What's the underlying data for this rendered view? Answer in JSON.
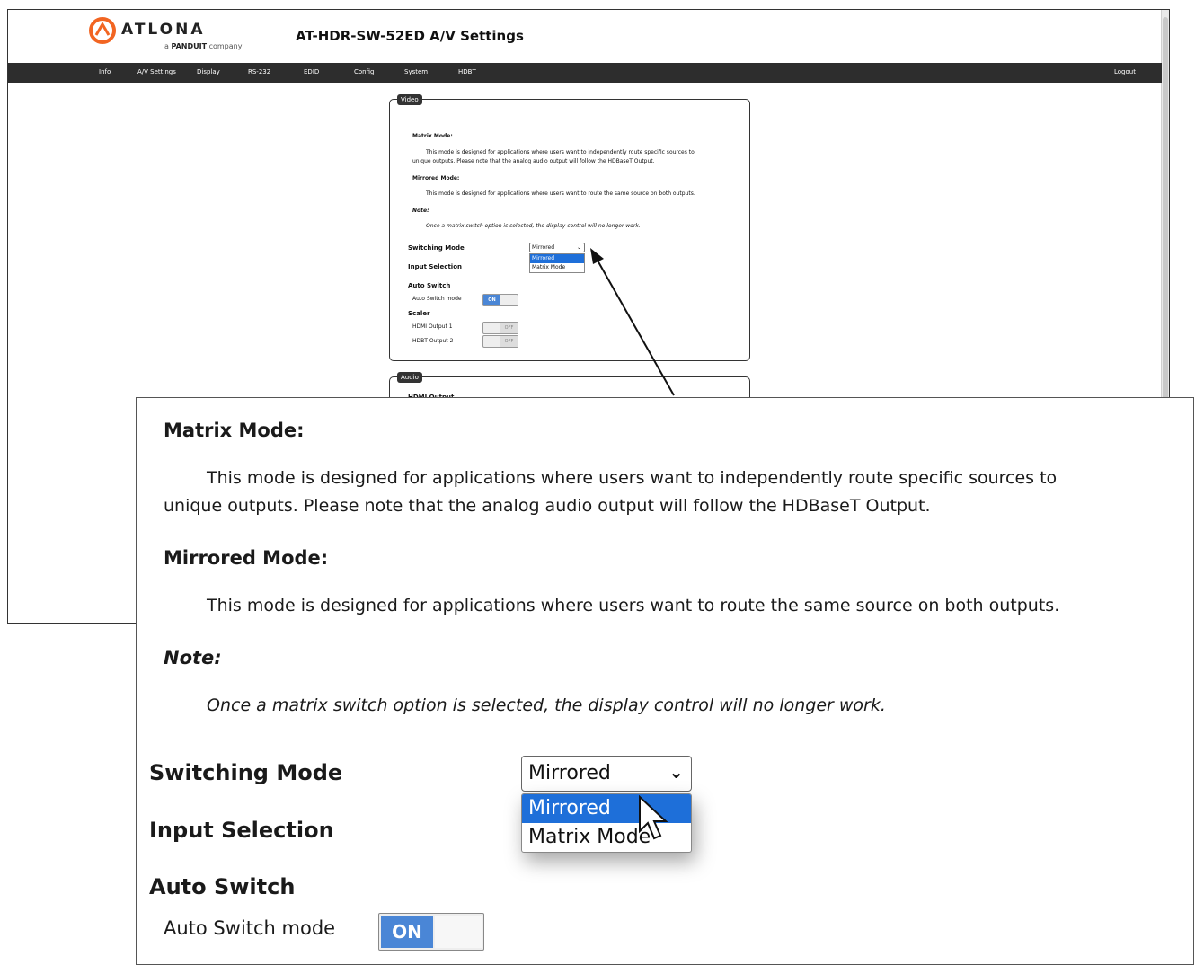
{
  "brand": {
    "name": "ATLONA",
    "tagline_prefix": "a",
    "tagline_brand": "PANDUIT",
    "tagline_suffix": "company",
    "accent": "#f26522"
  },
  "page": {
    "title": "AT-HDR-SW-52ED  A/V Settings"
  },
  "nav": {
    "items": [
      "Info",
      "A/V Settings",
      "Display",
      "RS-232",
      "EDID",
      "Config",
      "System",
      "HDBT"
    ],
    "logout": "Logout",
    "background": "#2d2d2d"
  },
  "video_panel": {
    "legend": "Video",
    "matrix_heading": "Matrix Mode:",
    "matrix_line1": "This mode is designed for applications where users want to independently route specific sources to",
    "matrix_line2": "unique outputs. Please note that the analog audio output will follow the HDBaseT Output.",
    "mirrored_heading": "Mirrored Mode:",
    "mirrored_text": "This mode is designed for applications where users want to route the same source on both outputs.",
    "note_heading": "Note:",
    "note_text": "Once a matrix switch option is selected, the display control will no longer work.",
    "switching_mode_label": "Switching Mode",
    "switching_mode_value": "Mirrored",
    "switching_mode_options": [
      "Mirrored",
      "Matrix Mode"
    ],
    "input_selection_label": "Input Selection",
    "auto_switch_label": "Auto Switch",
    "auto_switch_mode_label": "Auto Switch mode",
    "auto_switch_state": "ON",
    "scaler_label": "Scaler",
    "hdmi_output_label": "HDMI Output 1",
    "hdmi_output_state": "OFF",
    "hdbt_output_label": "HDBT Output 2",
    "hdbt_output_state": "OFF"
  },
  "audio_panel": {
    "legend": "Audio",
    "hdmi_output_label": "HDMI Output"
  },
  "colors": {
    "selected_option": "#1e6fd9",
    "toggle_on": "#4a86d6"
  }
}
